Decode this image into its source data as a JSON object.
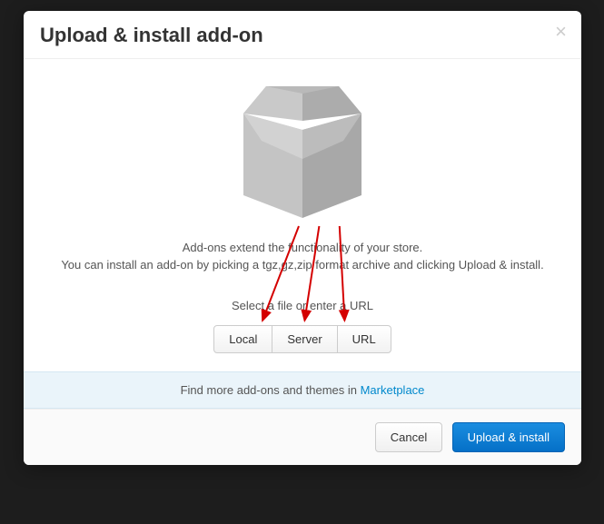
{
  "modal": {
    "title": "Upload & install add-on",
    "close_glyph": "×",
    "desc_line1": "Add-ons extend the functionality of your store.",
    "desc_line2": "You can install an add-on by picking a tgz,gz,zip format archive and clicking Upload & install.",
    "select_label": "Select a file or enter a URL",
    "source_buttons": {
      "local": "Local",
      "server": "Server",
      "url": "URL"
    },
    "marketplace_text": "Find more add-ons and themes in ",
    "marketplace_link": "Marketplace",
    "footer": {
      "cancel": "Cancel",
      "submit": "Upload & install"
    }
  }
}
